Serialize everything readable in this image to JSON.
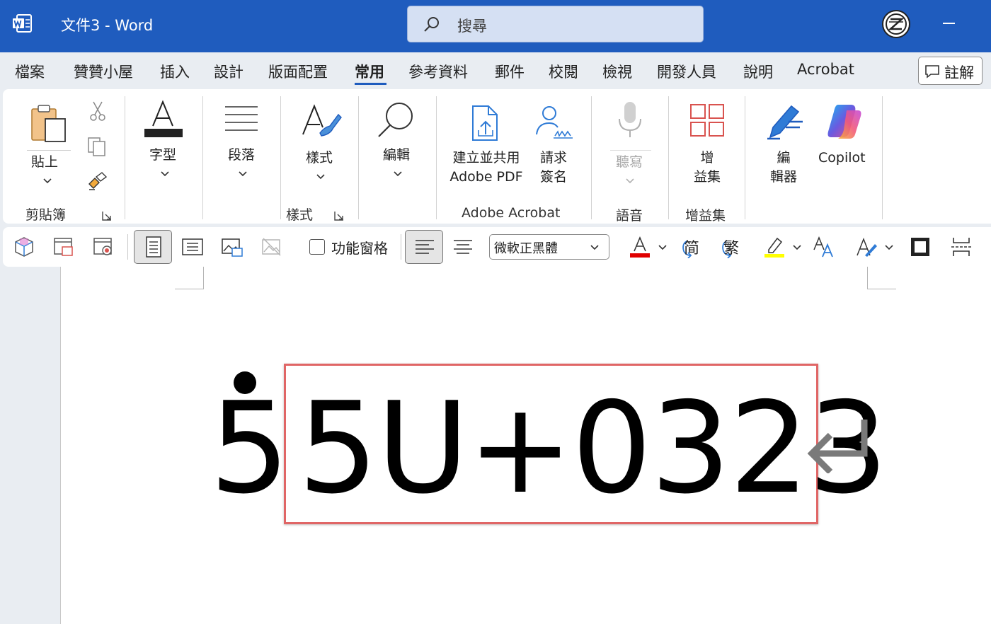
{
  "app": {
    "title": "文件3  -  Word",
    "search_placeholder": "搜尋"
  },
  "menu": {
    "tabs": [
      {
        "label": "檔案"
      },
      {
        "label": "贊贊小屋"
      },
      {
        "label": "插入"
      },
      {
        "label": "設計"
      },
      {
        "label": "版面配置"
      },
      {
        "label": "常用",
        "active": true
      },
      {
        "label": "參考資料"
      },
      {
        "label": "郵件"
      },
      {
        "label": "校閱"
      },
      {
        "label": "檢視"
      },
      {
        "label": "開發人員"
      },
      {
        "label": "說明"
      },
      {
        "label": "Acrobat"
      }
    ],
    "comment_button": "註解"
  },
  "ribbon": {
    "paste": "貼上",
    "clipboard_group": "剪貼簿",
    "font": "字型",
    "paragraph": "段落",
    "styles": "樣式",
    "styles_group": "樣式",
    "editing": "編輯",
    "create_pdf_line1": "建立並共用",
    "create_pdf_line2": "Adobe PDF",
    "request_sign_line1": "請求",
    "request_sign_line2": "簽名",
    "acrobat_group": "Adobe Acrobat",
    "dictate": "聽寫",
    "voice_group": "語音",
    "addins_line1": "增",
    "addins_line2": "益集",
    "addins_group": "增益集",
    "editor_line1": "編",
    "editor_line2": "輯器",
    "copilot": "Copilot"
  },
  "toolbar": {
    "nav_pane_label": "功能窗格",
    "font_name": "微軟正黑體",
    "simplified": "简",
    "traditional": "繁",
    "font_color": "#e00000",
    "highlight_color": "#ffff00"
  },
  "document": {
    "char_with_dot": "5",
    "code_text": "5U+0323",
    "highlight_border": "#e06666"
  }
}
